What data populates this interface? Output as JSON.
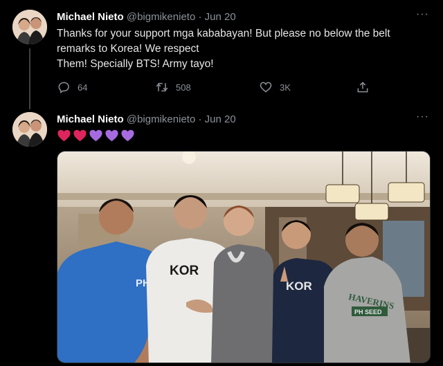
{
  "tweets": [
    {
      "author_name": "Michael Nieto",
      "handle": "@bigmikenieto",
      "separator": "·",
      "date": "Jun 20",
      "more": "···",
      "text_lines": [
        "Thanks for your support mga kababayan! But please no below the belt",
        "remarks to Korea! We respect",
        "Them! Specially BTS! Army tayo!"
      ],
      "replies": "64",
      "retweets": "508",
      "likes": "3K"
    },
    {
      "author_name": "Michael Nieto",
      "handle": "@bigmikenieto",
      "separator": "·",
      "date": "Jun 20",
      "more": "···",
      "hearts": [
        "red",
        "red",
        "purple",
        "purple",
        "purple"
      ],
      "photo_texts": {
        "shirt_kor_1": "KOR",
        "shirt_kor_2": "KOR",
        "shirt_phi": "PHI",
        "hoodie": "HAVERINS",
        "hoodie_patch": "PH SEED"
      }
    }
  ],
  "colors": {
    "background": "#000000",
    "heart_red": "#e0245e",
    "heart_purple": "#a66be0",
    "secondary_text": "#8b9298"
  },
  "icons": [
    "reply-icon",
    "retweet-icon",
    "like-icon",
    "share-icon",
    "more-icon"
  ]
}
